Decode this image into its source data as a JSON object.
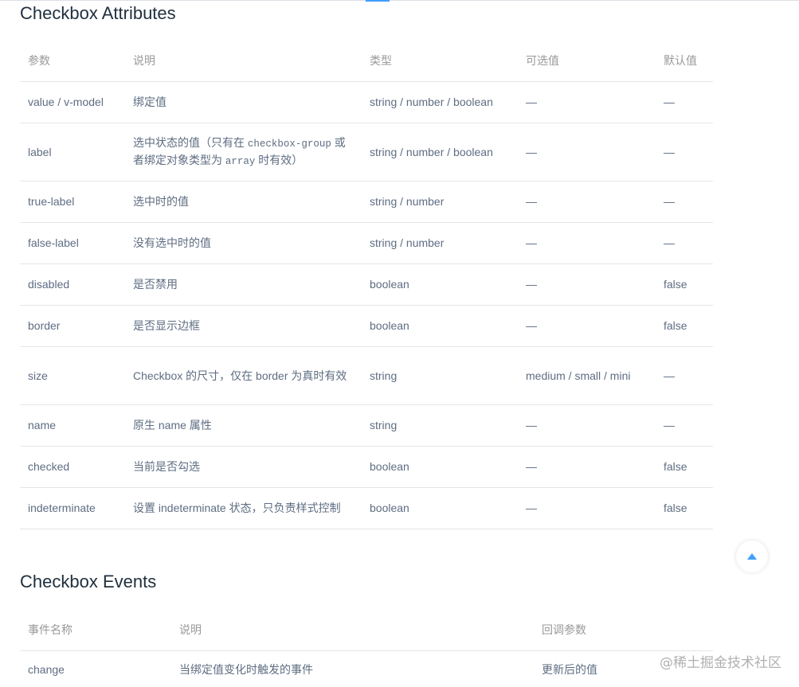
{
  "attributes": {
    "title": "Checkbox Attributes",
    "headers": [
      "参数",
      "说明",
      "类型",
      "可选值",
      "默认值"
    ],
    "rows": [
      {
        "param": "value / v-model",
        "desc": "绑定值",
        "type": "string / number / boolean",
        "options": "—",
        "default": "—"
      },
      {
        "param": "label",
        "desc_pre": "选中状态的值（只有在 ",
        "desc_code1": "checkbox-group",
        "desc_mid": " 或者绑定对象类型为 ",
        "desc_code2": "array",
        "desc_post": " 时有效）",
        "type": "string / number / boolean",
        "options": "—",
        "default": "—"
      },
      {
        "param": "true-label",
        "desc": "选中时的值",
        "type": "string / number",
        "options": "—",
        "default": "—"
      },
      {
        "param": "false-label",
        "desc": "没有选中时的值",
        "type": "string / number",
        "options": "—",
        "default": "—"
      },
      {
        "param": "disabled",
        "desc": "是否禁用",
        "type": "boolean",
        "options": "—",
        "default": "false"
      },
      {
        "param": "border",
        "desc": "是否显示边框",
        "type": "boolean",
        "options": "—",
        "default": "false"
      },
      {
        "param": "size",
        "desc": "Checkbox 的尺寸，仅在 border 为真时有效",
        "type": "string",
        "options": "medium / small / mini",
        "default": "—"
      },
      {
        "param": "name",
        "desc": "原生 name 属性",
        "type": "string",
        "options": "—",
        "default": "—"
      },
      {
        "param": "checked",
        "desc": "当前是否勾选",
        "type": "boolean",
        "options": "—",
        "default": "false"
      },
      {
        "param": "indeterminate",
        "desc": "设置 indeterminate 状态，只负责样式控制",
        "type": "boolean",
        "options": "—",
        "default": "false"
      }
    ]
  },
  "events": {
    "title": "Checkbox Events",
    "headers": [
      "事件名称",
      "说明",
      "回调参数"
    ],
    "rows": [
      {
        "name": "change",
        "desc": "当绑定值变化时触发的事件",
        "params": "更新后的值"
      }
    ]
  },
  "watermark": "@稀土掘金技术社区",
  "colors": {
    "accent": "#409eff",
    "title": "#1f2f3d",
    "text": "#5e6d82",
    "header": "#999999",
    "border": "#e6e6e6"
  }
}
